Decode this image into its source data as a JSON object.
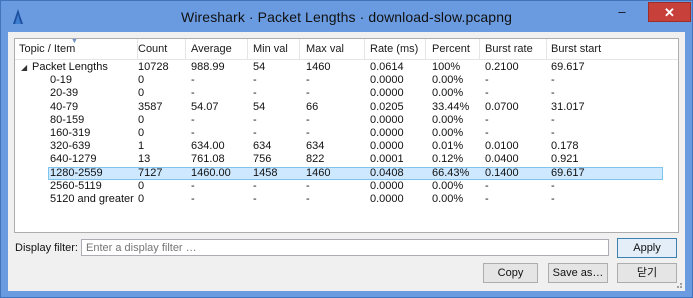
{
  "window": {
    "title": "Wireshark · Packet Lengths · download-slow.pcapng",
    "minimize_glyph": "–",
    "maximize_glyph": "□",
    "close_glyph": "✕"
  },
  "icons": {
    "app": "wireshark-fin-icon",
    "expander": "expand-triangle-icon",
    "sort": "sort-indicator-icon",
    "grip": "resize-grip-icon"
  },
  "colors": {
    "titlebar": "#6a9be0",
    "close_button": "#c7403a",
    "selection": "#cde8ff",
    "selection_border": "#7fc4ec"
  },
  "table": {
    "columns": [
      "Topic / Item",
      "Count",
      "Average",
      "Min val",
      "Max val",
      "Rate (ms)",
      "Percent",
      "Burst rate",
      "Burst start"
    ],
    "parent": {
      "expander": "◢",
      "cells": [
        "Packet Lengths",
        "10728",
        "988.99",
        "54",
        "1460",
        "0.0614",
        "100%",
        "0.2100",
        "69.617"
      ]
    },
    "rows": [
      [
        "0-19",
        "0",
        "-",
        "-",
        "-",
        "0.0000",
        "0.00%",
        "-",
        "-"
      ],
      [
        "20-39",
        "0",
        "-",
        "-",
        "-",
        "0.0000",
        "0.00%",
        "-",
        "-"
      ],
      [
        "40-79",
        "3587",
        "54.07",
        "54",
        "66",
        "0.0205",
        "33.44%",
        "0.0700",
        "31.017"
      ],
      [
        "80-159",
        "0",
        "-",
        "-",
        "-",
        "0.0000",
        "0.00%",
        "-",
        "-"
      ],
      [
        "160-319",
        "0",
        "-",
        "-",
        "-",
        "0.0000",
        "0.00%",
        "-",
        "-"
      ],
      [
        "320-639",
        "1",
        "634.00",
        "634",
        "634",
        "0.0000",
        "0.01%",
        "0.0100",
        "0.178"
      ],
      [
        "640-1279",
        "13",
        "761.08",
        "756",
        "822",
        "0.0001",
        "0.12%",
        "0.0400",
        "0.921"
      ],
      [
        "1280-2559",
        "7127",
        "1460.00",
        "1458",
        "1460",
        "0.0408",
        "66.43%",
        "0.1400",
        "69.617"
      ],
      [
        "2560-5119",
        "0",
        "-",
        "-",
        "-",
        "0.0000",
        "0.00%",
        "-",
        "-"
      ],
      [
        "5120 and greater",
        "0",
        "-",
        "-",
        "-",
        "0.0000",
        "0.00%",
        "-",
        "-"
      ]
    ],
    "selected_index": 7
  },
  "filter": {
    "label": "Display filter:",
    "placeholder": "Enter a display filter …",
    "value": ""
  },
  "buttons": {
    "apply": "Apply",
    "copy": "Copy",
    "save_as": "Save as…",
    "close": "닫기"
  }
}
